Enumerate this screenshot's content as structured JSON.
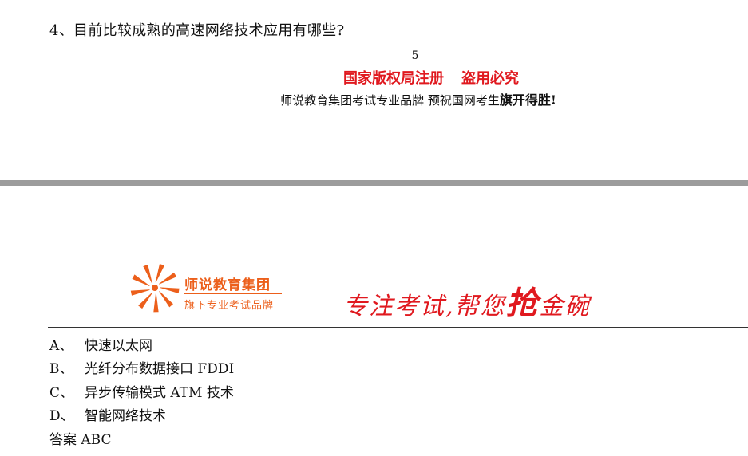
{
  "question": {
    "text": "4、目前比较成熟的高速网络技术应用有哪些?"
  },
  "page_number": "5",
  "copyright": {
    "left": "国家版权局注册",
    "right": "盗用必究"
  },
  "slogan": {
    "text": "师说教育集团考试专业品牌  预祝国网考生",
    "emphasis": "旗开得胜!"
  },
  "logo": {
    "name": "师说教育集团",
    "subtitle": "旗下专业考试品牌",
    "color": "#ec5f1b"
  },
  "motto": {
    "pre": "专注考试,帮您",
    "highlight": "抢",
    "post": "金碗",
    "color": "#e0191f"
  },
  "options": [
    {
      "label": "A、",
      "text": "快速以太网"
    },
    {
      "label": "B、",
      "text": "光纤分布数据接口 FDDI"
    },
    {
      "label": "C、",
      "text": "异步传输模式 ATM 技术"
    },
    {
      "label": "D、",
      "text": "智能网络技术"
    }
  ],
  "answer": {
    "text": "答案 ABC"
  }
}
